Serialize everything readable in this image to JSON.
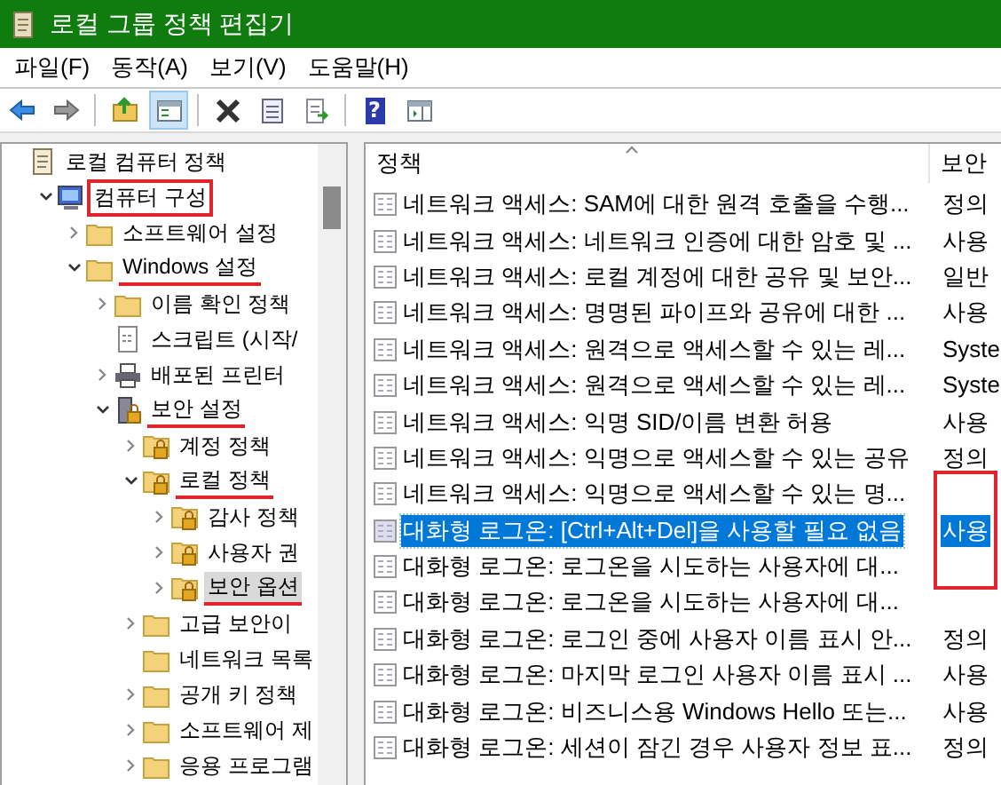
{
  "window": {
    "title": "로컬 그룹 정책 편집기"
  },
  "menu": [
    "파일(F)",
    "동작(A)",
    "보기(V)",
    "도움말(H)"
  ],
  "toolbar": [
    {
      "kind": "back",
      "pressed": false
    },
    {
      "kind": "forward",
      "pressed": false
    },
    {
      "kind": "separator"
    },
    {
      "kind": "up",
      "pressed": false
    },
    {
      "kind": "tree",
      "pressed": true
    },
    {
      "kind": "separator"
    },
    {
      "kind": "delete",
      "pressed": false
    },
    {
      "kind": "properties",
      "pressed": false
    },
    {
      "kind": "export",
      "pressed": false
    },
    {
      "kind": "separator"
    },
    {
      "kind": "help",
      "pressed": false,
      "glyph": "?"
    },
    {
      "kind": "pane",
      "pressed": false
    }
  ],
  "tree": [
    {
      "label": "로컬 컴퓨터 정책",
      "kind": "policy",
      "selected": false,
      "boxed": false,
      "underlined": false,
      "children": [
        {
          "label": "컴퓨터 구성",
          "kind": "computer",
          "expanded": true,
          "selected": false,
          "boxed": true,
          "underlined": false,
          "children": [
            {
              "label": "소프트웨어 설정",
              "kind": "folder",
              "expanded": false,
              "selected": false,
              "boxed": false,
              "underlined": false
            },
            {
              "label": "Windows 설정",
              "kind": "folder",
              "expanded": true,
              "selected": false,
              "boxed": false,
              "underlined": true,
              "children": [
                {
                  "label": "이름 확인 정책",
                  "kind": "folder",
                  "expanded": false,
                  "selected": false,
                  "boxed": false,
                  "underlined": false
                },
                {
                  "label": "스크립트 (시작/",
                  "kind": "script",
                  "selected": false,
                  "boxed": false,
                  "underlined": false
                },
                {
                  "label": "배포된 프린터",
                  "kind": "printer",
                  "expanded": false,
                  "selected": false,
                  "boxed": false,
                  "underlined": false
                },
                {
                  "label": "보안 설정",
                  "kind": "secure",
                  "expanded": true,
                  "selected": false,
                  "boxed": false,
                  "underlined": true,
                  "children": [
                    {
                      "label": "계정 정책",
                      "kind": "lockfolder",
                      "expanded": false,
                      "selected": false,
                      "boxed": false,
                      "underlined": false
                    },
                    {
                      "label": "로컬 정책",
                      "kind": "lockfolder",
                      "expanded": true,
                      "selected": false,
                      "boxed": false,
                      "underlined": true,
                      "children": [
                        {
                          "label": "감사 정책",
                          "kind": "lockfolder",
                          "expanded": false,
                          "selected": false,
                          "boxed": false,
                          "underlined": false
                        },
                        {
                          "label": "사용자 권",
                          "kind": "lockfolder",
                          "expanded": false,
                          "selected": false,
                          "boxed": false,
                          "underlined": false
                        },
                        {
                          "label": "보안 옵션",
                          "kind": "lockfolder",
                          "expanded": false,
                          "selected": true,
                          "boxed": false,
                          "underlined": true
                        }
                      ]
                    },
                    {
                      "label": "고급 보안이",
                      "kind": "folder",
                      "expanded": false,
                      "selected": false,
                      "boxed": false,
                      "underlined": false
                    },
                    {
                      "label": "네트워크 목록",
                      "kind": "folder",
                      "selected": false,
                      "boxed": false,
                      "underlined": false
                    },
                    {
                      "label": "공개 키 정책",
                      "kind": "folder",
                      "expanded": false,
                      "selected": false,
                      "boxed": false,
                      "underlined": false
                    },
                    {
                      "label": "소프트웨어 제",
                      "kind": "folder",
                      "expanded": false,
                      "selected": false,
                      "boxed": false,
                      "underlined": false
                    },
                    {
                      "label": "응용 프로그램",
                      "kind": "folder",
                      "expanded": false,
                      "selected": false,
                      "boxed": false,
                      "underlined": false
                    }
                  ]
                }
              ]
            }
          ]
        }
      ]
    }
  ],
  "table": {
    "columns": [
      "정책",
      "보안"
    ],
    "rows": [
      {
        "policy": "네트워크 액세스: SAM에 대한 원격 호출을 수행...",
        "setting": "정의",
        "selected": false,
        "marked": false
      },
      {
        "policy": "네트워크 액세스: 네트워크 인증에 대한 암호 및 ...",
        "setting": "사용",
        "selected": false,
        "marked": false
      },
      {
        "policy": "네트워크 액세스: 로컬 계정에 대한 공유 및 보안...",
        "setting": "일반",
        "selected": false,
        "marked": false
      },
      {
        "policy": "네트워크 액세스: 명명된 파이프와 공유에 대한 ...",
        "setting": "사용",
        "selected": false,
        "marked": false
      },
      {
        "policy": "네트워크 액세스: 원격으로 액세스할 수 있는 레...",
        "setting": "Syste",
        "selected": false,
        "marked": false
      },
      {
        "policy": "네트워크 액세스: 원격으로 액세스할 수 있는 레...",
        "setting": "Syste",
        "selected": false,
        "marked": false
      },
      {
        "policy": "네트워크 액세스: 익명 SID/이름 변환 허용",
        "setting": "사용",
        "selected": false,
        "marked": false
      },
      {
        "policy": "네트워크 액세스: 익명으로 액세스할 수 있는 공유",
        "setting": "정의",
        "selected": false,
        "marked": false
      },
      {
        "policy": "네트워크 액세스: 익명으로 액세스할 수 있는 명...",
        "selected": false,
        "marked": true
      },
      {
        "policy": "대화형 로그온: [Ctrl+Alt+Del]을 사용할 필요 없음",
        "setting": "사용",
        "selected": true,
        "marked": true
      },
      {
        "policy": "대화형 로그온: 로그온을 시도하는 사용자에 대...",
        "selected": false,
        "marked": true
      },
      {
        "policy": "대화형 로그온: 로그온을 시도하는 사용자에 대...",
        "selected": false,
        "marked": false
      },
      {
        "policy": "대화형 로그온: 로그인 중에 사용자 이름 표시 안...",
        "setting": "정의",
        "selected": false,
        "marked": false
      },
      {
        "policy": "대화형 로그온: 마지막 로그인 사용자 이름 표시 ...",
        "setting": "사용",
        "selected": false,
        "marked": false
      },
      {
        "policy": "대화형 로그온: 비즈니스용 Windows Hello 또는...",
        "setting": "사용",
        "selected": false,
        "marked": false
      },
      {
        "policy": "대화형 로그온: 세션이 잠긴 경우 사용자 정보 표...",
        "setting": "정의",
        "selected": false,
        "marked": false
      }
    ]
  }
}
